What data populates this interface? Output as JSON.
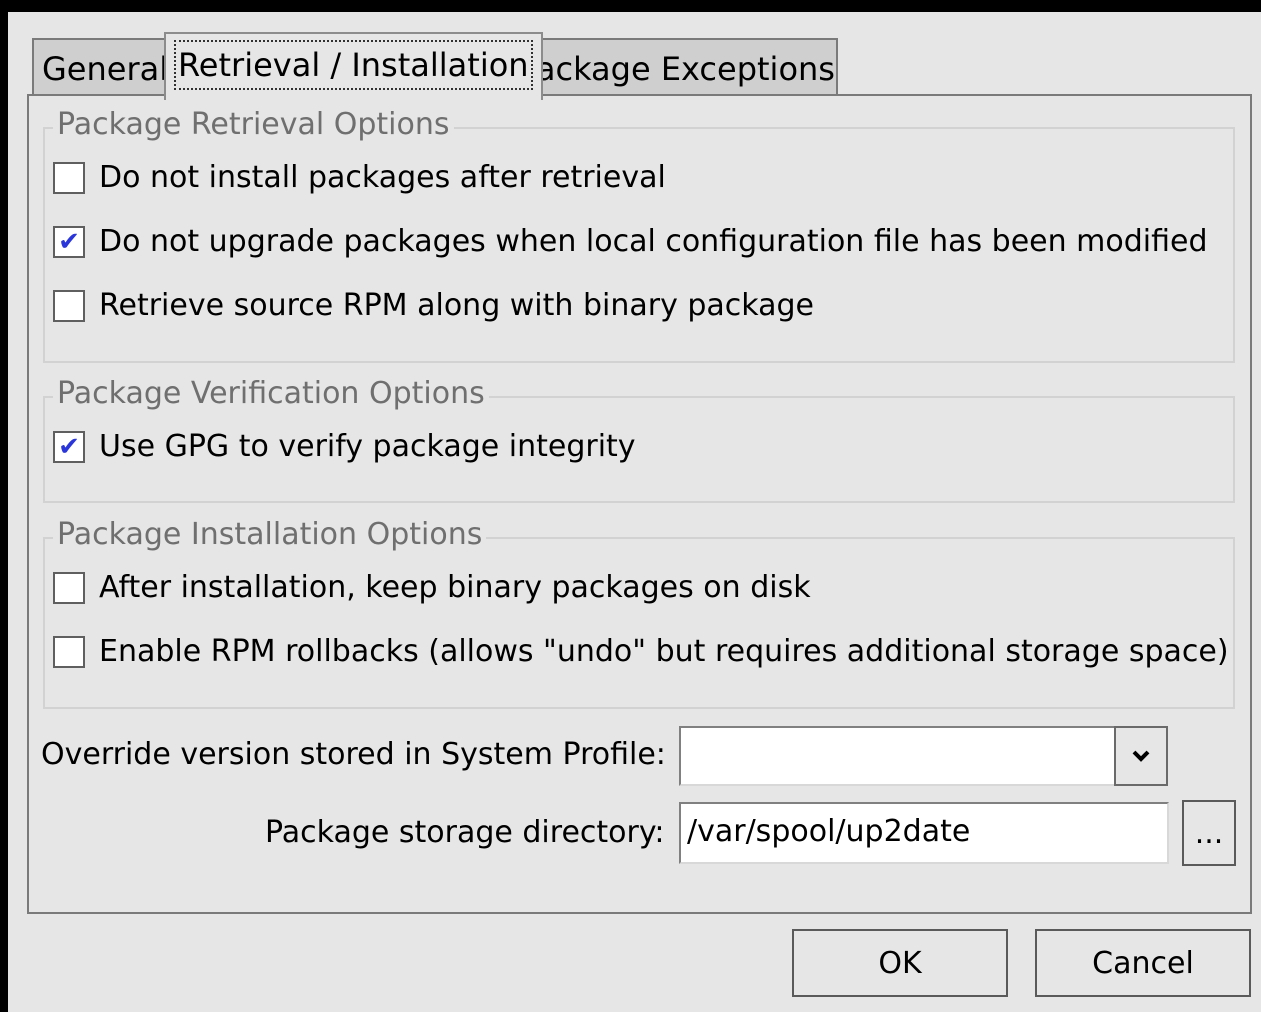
{
  "tabs": [
    {
      "label": "General",
      "active": false
    },
    {
      "label": "Retrieval / Installation",
      "active": true
    },
    {
      "label": "Package Exceptions",
      "active": false
    }
  ],
  "retrieval": {
    "title": "Package Retrieval Options",
    "options": [
      {
        "label": "Do not install packages after retrieval",
        "checked": false
      },
      {
        "label": "Do not upgrade packages when local configuration file has been modified",
        "checked": true
      },
      {
        "label": "Retrieve source RPM along with binary package",
        "checked": false
      }
    ]
  },
  "verification": {
    "title": "Package Verification Options",
    "options": [
      {
        "label": "Use GPG to verify package integrity",
        "checked": true
      }
    ]
  },
  "installation": {
    "title": "Package Installation Options",
    "options": [
      {
        "label": "After installation, keep binary packages on disk",
        "checked": false
      },
      {
        "label": "Enable RPM rollbacks  (allows \"undo\" but requires additional storage space)",
        "checked": false
      }
    ]
  },
  "override": {
    "label": "Override version stored in System Profile:",
    "value": ""
  },
  "storage": {
    "label": "Package storage directory:",
    "value": "/var/spool/up2date",
    "browse_label": "..."
  },
  "buttons": {
    "ok": "OK",
    "cancel": "Cancel"
  },
  "colors": {
    "check_mark": "#2a36d9",
    "frame_title": "#6f6f6f",
    "window_bg": "#e6e6e6"
  },
  "icons": {
    "check": "✔",
    "dropdown": "chevron-down-icon"
  }
}
